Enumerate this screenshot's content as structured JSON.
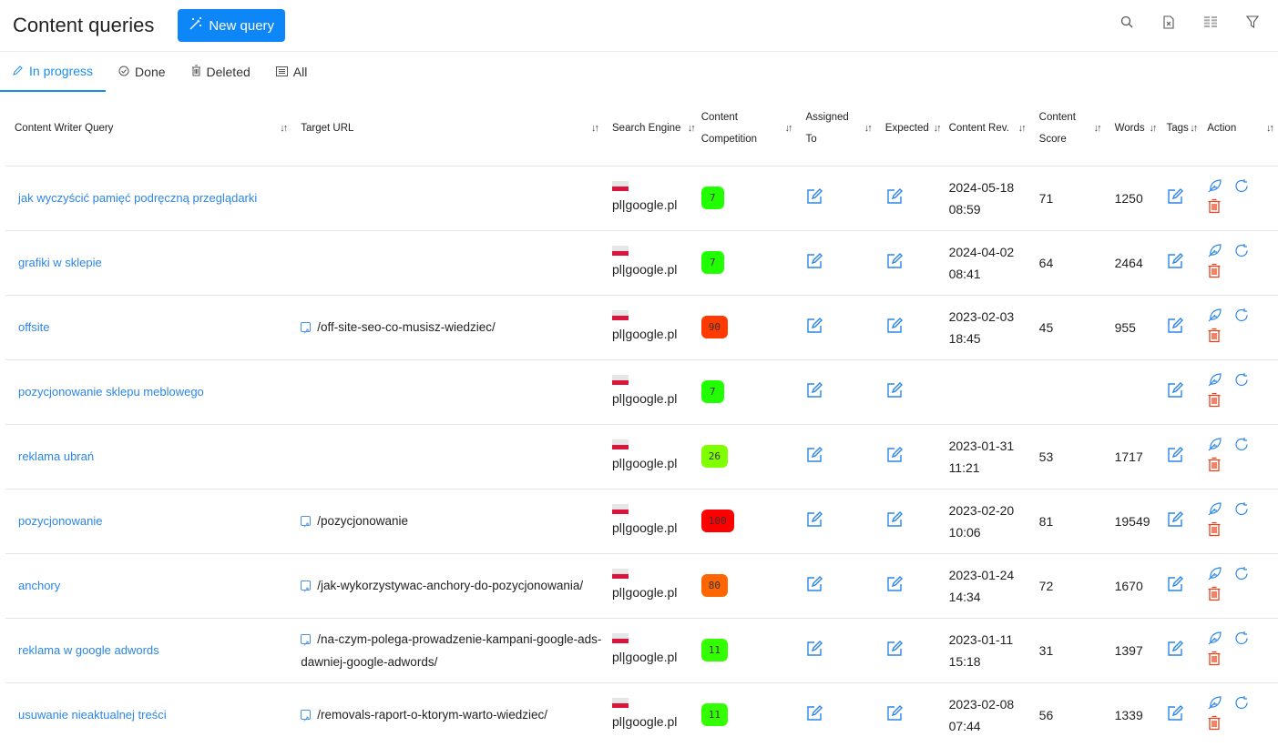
{
  "header": {
    "title": "Content queries",
    "new_query_label": "New query",
    "tools": [
      "search-icon",
      "excel-export-icon",
      "columns-icon",
      "filter-icon"
    ]
  },
  "tabs": [
    {
      "label": "In progress",
      "icon": "pencil-icon",
      "active": true
    },
    {
      "label": "Done",
      "icon": "check-circle-icon",
      "active": false
    },
    {
      "label": "Deleted",
      "icon": "trash-icon",
      "active": false
    },
    {
      "label": "All",
      "icon": "list-icon",
      "active": false
    }
  ],
  "columns": [
    {
      "label": "Content Writer Query"
    },
    {
      "label": "Target URL"
    },
    {
      "label": "Search Engine"
    },
    {
      "label": "Content Competition"
    },
    {
      "label": "Assigned To"
    },
    {
      "label": "Expected"
    },
    {
      "label": "Content Rev."
    },
    {
      "label": "Content Score"
    },
    {
      "label": "Words"
    },
    {
      "label": "Tags"
    },
    {
      "label": "Action"
    }
  ],
  "colors": {
    "accent": "#0d86f7",
    "link": "#2b86e6",
    "delete": "#e8411a"
  },
  "rows": [
    {
      "query": "jak wyczyścić pamięć podręczną przeglądarki",
      "url": "",
      "engine": "pl|google.pl",
      "competition": "7",
      "competition_color": "#22ff00",
      "rev_date": "2024-05-18",
      "rev_time": "08:59",
      "score": "71",
      "words": "1250"
    },
    {
      "query": "grafiki w sklepie",
      "url": "",
      "engine": "pl|google.pl",
      "competition": "7",
      "competition_color": "#22ff00",
      "rev_date": "2024-04-02",
      "rev_time": "08:41",
      "score": "64",
      "words": "2464"
    },
    {
      "query": "offsite",
      "url": "/off-site-seo-co-musisz-wiedziec/",
      "engine": "pl|google.pl",
      "competition": "90",
      "competition_color": "#ff3a00",
      "rev_date": "2023-02-03",
      "rev_time": "18:45",
      "score": "45",
      "words": "955"
    },
    {
      "query": "pozycjonowanie sklepu meblowego",
      "url": "",
      "engine": "pl|google.pl",
      "competition": "7",
      "competition_color": "#22ff00",
      "rev_date": "",
      "rev_time": "",
      "score": "",
      "words": ""
    },
    {
      "query": "reklama ubrań",
      "url": "",
      "engine": "pl|google.pl",
      "competition": "26",
      "competition_color": "#7fff00",
      "rev_date": "2023-01-31",
      "rev_time": "11:21",
      "score": "53",
      "words": "1717"
    },
    {
      "query": "pozycjonowanie",
      "url": "/pozycjonowanie",
      "engine": "pl|google.pl",
      "competition": "100",
      "competition_color": "#ff0000",
      "rev_date": "2023-02-20",
      "rev_time": "10:06",
      "score": "81",
      "words": "19549"
    },
    {
      "query": "anchory",
      "url": "/jak-wykorzystywac-anchory-do-pozycjonowania/",
      "engine": "pl|google.pl",
      "competition": "80",
      "competition_color": "#ff6600",
      "rev_date": "2023-01-24",
      "rev_time": "14:34",
      "score": "72",
      "words": "1670"
    },
    {
      "query": "reklama w google adwords",
      "url": "/na-czym-polega-prowadzenie-kampani-google-ads-dawniej-google-adwords/",
      "engine": "pl|google.pl",
      "competition": "11",
      "competition_color": "#33ff00",
      "rev_date": "2023-01-11",
      "rev_time": "15:18",
      "score": "31",
      "words": "1397"
    },
    {
      "query": "usuwanie nieaktualnej treści",
      "url": "/removals-raport-o-ktorym-warto-wiedziec/",
      "engine": "pl|google.pl",
      "competition": "11",
      "competition_color": "#33ff00",
      "rev_date": "2023-02-08",
      "rev_time": "07:44",
      "score": "56",
      "words": "1339"
    }
  ]
}
